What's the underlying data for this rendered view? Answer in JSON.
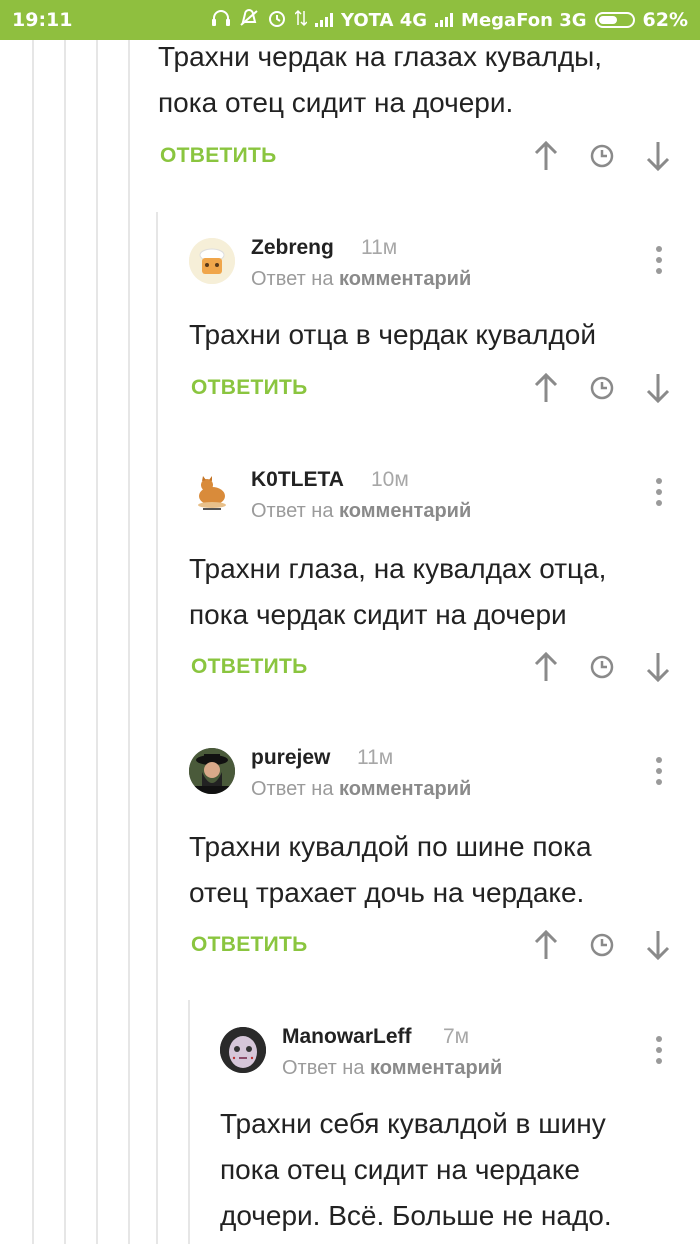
{
  "status_bar": {
    "time": "19:11",
    "carrier1": "YOTA 4G",
    "carrier2": "MegaFon 3G",
    "battery": "62%",
    "battery_level": 0.62,
    "icons": [
      "headphones-icon",
      "mute-icon",
      "alarm-icon",
      "data-arrows-icon",
      "signal-icon"
    ]
  },
  "colors": {
    "status_bar": "#8fbf3f",
    "reply_green": "#8ac53f",
    "thread_line": "#e6e6e6"
  },
  "comments": [
    {
      "text_lines": [
        "Трахни чердак на глазах кувалды,",
        "пока отец сидит на дочери."
      ],
      "reply_label": "ОТВЕТИТЬ"
    },
    {
      "author": "Zebreng",
      "time": "11м",
      "reply_prefix": "Ответ на",
      "reply_target": "комментарий",
      "text_lines": [
        "Трахни отца в чердак кувалдой"
      ],
      "reply_label": "ОТВЕТИТЬ"
    },
    {
      "author": "K0TLETA",
      "time": "10м",
      "reply_prefix": "Ответ на",
      "reply_target": "комментарий",
      "text_lines": [
        "Трахни глаза, на кувалдах отца,",
        "пока чердак сидит на дочери"
      ],
      "reply_label": "ОТВЕТИТЬ"
    },
    {
      "author": "purejew",
      "time": "11м",
      "reply_prefix": "Ответ на",
      "reply_target": "комментарий",
      "text_lines": [
        "Трахни кувалдой по шине пока",
        "отец трахает дочь на чердаке."
      ],
      "reply_label": "ОТВЕТИТЬ"
    },
    {
      "author": "ManowarLeff",
      "time": "7м",
      "reply_prefix": "Ответ на",
      "reply_target": "комментарий",
      "text_lines": [
        "Трахни себя кувалдой в шину",
        "пока отец сидит на чердаке",
        "дочери. Всё. Больше не надо."
      ]
    }
  ]
}
